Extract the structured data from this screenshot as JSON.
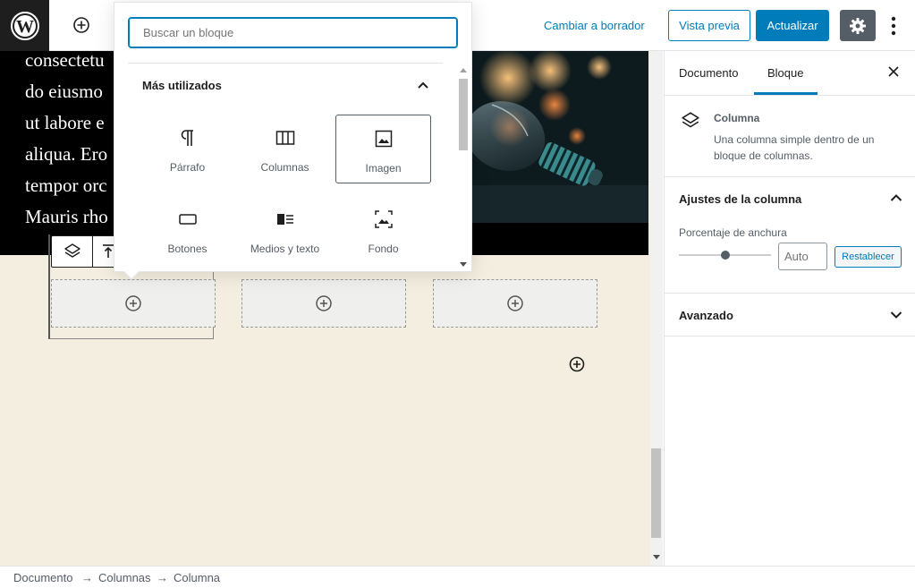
{
  "topbar": {
    "switch_to_draft": "Cambiar a borrador",
    "preview": "Vista previa",
    "update": "Actualizar"
  },
  "canvas": {
    "cover_lines": [
      "consectetu",
      "do eiusmo",
      "ut labore e",
      "aliqua. Ero",
      "tempor orc",
      "Mauris rho"
    ]
  },
  "inserter": {
    "search_placeholder": "Buscar un bloque",
    "section_title": "Más utilizados",
    "blocks": [
      {
        "label": "Párrafo",
        "icon": "paragraph-icon"
      },
      {
        "label": "Columnas",
        "icon": "columns-icon"
      },
      {
        "label": "Imagen",
        "icon": "image-icon",
        "selected": true
      },
      {
        "label": "Botones",
        "icon": "buttons-icon"
      },
      {
        "label": "Medios y texto",
        "icon": "media-text-icon"
      },
      {
        "label": "Fondo",
        "icon": "cover-icon"
      }
    ]
  },
  "sidebar": {
    "tabs": [
      "Documento",
      "Bloque"
    ],
    "active_tab": "Bloque",
    "block": {
      "title": "Columna",
      "description": "Una columna simple dentro de un bloque de columnas."
    },
    "column_settings": {
      "title": "Ajustes de la columna",
      "width_label": "Porcentaje de anchura",
      "width_placeholder": "Auto",
      "reset": "Restablecer"
    },
    "advanced": {
      "title": "Avanzado"
    }
  },
  "breadcrumb": [
    "Documento",
    "Columnas",
    "Columna"
  ],
  "colors": {
    "accent": "#007cba",
    "canvas_bg": "#f4eee0",
    "toolbar_dark": "#1e1e1e"
  }
}
